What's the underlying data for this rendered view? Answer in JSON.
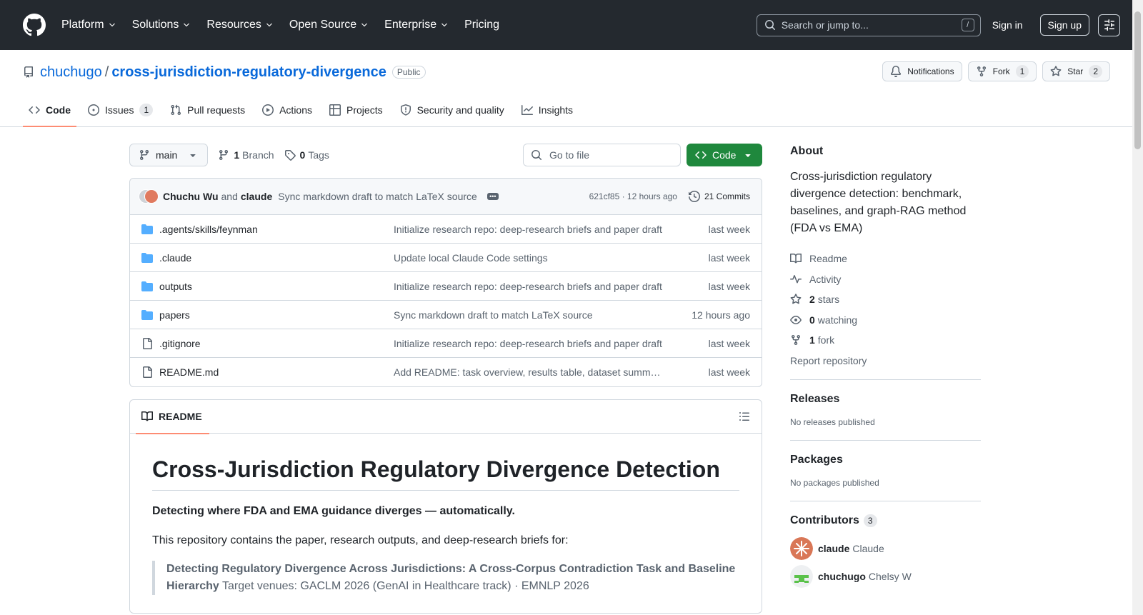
{
  "header": {
    "nav": [
      "Platform",
      "Solutions",
      "Resources",
      "Open Source",
      "Enterprise"
    ],
    "pricing": "Pricing",
    "search_placeholder": "Search or jump to...",
    "search_shortcut": "/",
    "signin": "Sign in",
    "signup": "Sign up"
  },
  "repo": {
    "owner": "chuchugo",
    "separator": "/",
    "name": "cross-jurisdiction-regulatory-divergence",
    "visibility": "Public",
    "notifications": "Notifications",
    "fork_label": "Fork",
    "fork_count": "1",
    "star_label": "Star",
    "star_count": "2"
  },
  "tabs": {
    "code": "Code",
    "issues": "Issues",
    "issues_count": "1",
    "pulls": "Pull requests",
    "actions": "Actions",
    "projects": "Projects",
    "security": "Security and quality",
    "insights": "Insights"
  },
  "toolbar": {
    "branch": "main",
    "branch_count": "1",
    "branch_label": "Branch",
    "tag_count": "0",
    "tag_label": "Tags",
    "goto_placeholder": "Go to file",
    "code_button": "Code"
  },
  "commit": {
    "author1": "Chuchu Wu",
    "and": "and",
    "author2": "claude",
    "message": "Sync markdown draft to match LaTeX source",
    "hash_time": "621cf85 · 12 hours ago",
    "commits": "21 Commits"
  },
  "files": [
    {
      "name": ".agents/skills/feynman",
      "type": "folder",
      "msg": "Initialize research repo: deep-research briefs and paper draft",
      "date": "last week"
    },
    {
      "name": ".claude",
      "type": "folder",
      "msg": "Update local Claude Code settings",
      "date": "last week"
    },
    {
      "name": "outputs",
      "type": "folder",
      "msg": "Initialize research repo: deep-research briefs and paper draft",
      "date": "last week"
    },
    {
      "name": "papers",
      "type": "folder",
      "msg": "Sync markdown draft to match LaTeX source",
      "date": "12 hours ago"
    },
    {
      "name": ".gitignore",
      "type": "file",
      "msg": "Initialize research repo: deep-research briefs and paper draft",
      "date": "last week"
    },
    {
      "name": "README.md",
      "type": "file",
      "msg": "Add README: task overview, results table, dataset summar…",
      "date": "last week"
    }
  ],
  "readme": {
    "tab": "README",
    "h1": "Cross-Jurisdiction Regulatory Divergence Detection",
    "lead": "Detecting where FDA and EMA guidance diverges — automatically.",
    "intro": "This repository contains the paper, research outputs, and deep-research briefs for:",
    "quote_bold": "Detecting Regulatory Divergence Across Jurisdictions: A Cross-Corpus Contradiction Task and Baseline Hierarchy",
    "quote_rest": " Target venues: GACLM 2026 (GenAI in Healthcare track) · EMNLP 2026"
  },
  "sidebar": {
    "about_title": "About",
    "about_desc": "Cross-jurisdiction regulatory divergence detection: benchmark, baselines, and graph-RAG method (FDA vs EMA)",
    "readme": "Readme",
    "activity": "Activity",
    "stars_n": "2",
    "stars": "stars",
    "watching_n": "0",
    "watching": "watching",
    "fork_n": "1",
    "fork": "fork",
    "report": "Report repository",
    "releases_title": "Releases",
    "releases_note": "No releases published",
    "packages_title": "Packages",
    "packages_note": "No packages published",
    "contributors_title": "Contributors",
    "contributors_count": "3",
    "contributors": [
      {
        "login": "claude",
        "name": "Claude"
      },
      {
        "login": "chuchugo",
        "name": "Chelsy W"
      }
    ]
  },
  "colors": {
    "header_bg": "#24292f",
    "link": "#0969da",
    "primary_button": "#1f883d",
    "folder": "#54aeff",
    "active_tab_underline": "#fd8c73"
  }
}
